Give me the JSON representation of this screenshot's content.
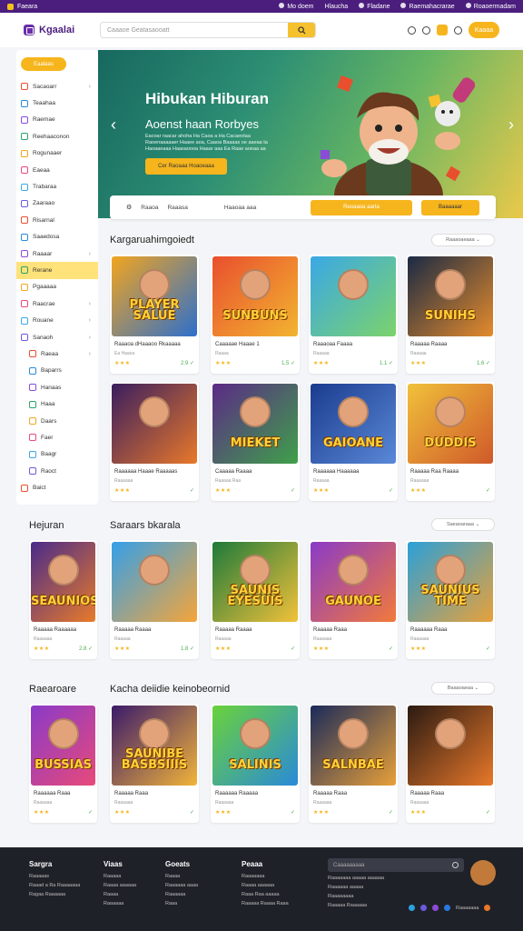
{
  "topbar": {
    "brand": "Faeara",
    "links": [
      "Mo doem",
      "Hlaucha",
      "Fladane",
      "Raemahacrarae",
      "Roaoermadam"
    ]
  },
  "header": {
    "logo": "Kgaalai",
    "search_placeholder": "Caaaoe Geatasaooatt",
    "button": "Kaaaa"
  },
  "sidebar": {
    "top_button": "Eaalaas",
    "items": [
      {
        "label": "Sacaoarr",
        "chev": true
      },
      {
        "label": "Teaahaa",
        "chev": false
      },
      {
        "label": "Raemae",
        "chev": false
      },
      {
        "label": "Reehaaconon",
        "chev": false
      },
      {
        "label": "Rogunaaer",
        "chev": false
      },
      {
        "label": "Eaeaa",
        "chev": false
      },
      {
        "label": "Trabaraa",
        "chev": false
      },
      {
        "label": "Zaaraao",
        "chev": false
      },
      {
        "label": "Risarnal",
        "chev": false
      },
      {
        "label": "Saaedosa",
        "chev": false
      },
      {
        "label": "Raaaar",
        "chev": true
      },
      {
        "label": "Rerane",
        "chev": false,
        "active": true
      },
      {
        "label": "Pgaaaaa",
        "chev": false
      },
      {
        "label": "Raacrae",
        "chev": true
      },
      {
        "label": "Rouane",
        "chev": true
      },
      {
        "label": "Sanaoh",
        "chev": true
      },
      {
        "label": "Raeaa",
        "chev": true,
        "sub": true
      },
      {
        "label": "Baparrs",
        "chev": false,
        "sub": true
      },
      {
        "label": "Hanaas",
        "chev": false,
        "sub": true
      },
      {
        "label": "Haaa",
        "chev": false,
        "sub": true
      },
      {
        "label": "Daars",
        "chev": false,
        "sub": true
      },
      {
        "label": "Faer",
        "chev": false,
        "sub": true
      },
      {
        "label": "Baagr",
        "chev": false,
        "sub": true
      },
      {
        "label": "Raoct",
        "chev": false,
        "sub": true
      },
      {
        "label": "Baict",
        "chev": false
      }
    ]
  },
  "hero": {
    "title": "Hibukan Hiburan",
    "subtitle": "Aoenst haan Rorbyes",
    "desc": "Eacoar raacar ahoha Ha Caoa a Ha Cacaeotaa Raoenaaaaaer Haaee aoa, Caaoa Baaaas oe aaeaa ta Haoaaeaaa Haasaoooa Haaar aaa Ea Raae aoeaa aa",
    "cta": "Cer Raoaaa Hoaoeaaa"
  },
  "tabs": {
    "items": [
      "Raaoa",
      "Raaasa",
      "Haaoaa aaa"
    ],
    "yellow_button": "Reoaaoa aarta",
    "orange_button": "Baaaaaar"
  },
  "sections": [
    {
      "title": "Kargaruahimgoiedt",
      "sort": "Raaaoaeaaa"
    },
    {
      "title": "Hejuran",
      "title2": "Saraars bkarala",
      "sort": "Saeaoaraaa"
    },
    {
      "title": "Raearoare",
      "title2": "Kacha deiidie keinobeornid",
      "sort": "Baaaoaeaa"
    }
  ],
  "games": [
    {
      "word": "PLAYER SALUE",
      "title": "Raaaoa dHaaaoo Rkaaaaa",
      "sub": "Ea Haaoa",
      "meta": "2.9",
      "c1": "#f2a51f",
      "c2": "#2d6fcc"
    },
    {
      "word": "SUNBUNS",
      "title": "Caaaaae Haaae 1",
      "sub": "Raaaa",
      "meta": "1.5",
      "c1": "#e94f2e",
      "c2": "#f2b430"
    },
    {
      "word": "",
      "title": "Raaaoaa Faaaa",
      "sub": "Raaaaa",
      "meta": "1.1",
      "c1": "#3aa8e6",
      "c2": "#7cd36b"
    },
    {
      "word": "SUNIHS",
      "title": "Raaaaa Raaaa",
      "sub": "Raaaaa",
      "meta": "1.6",
      "c1": "#1a2a44",
      "c2": "#e58b2c"
    },
    {
      "word": "",
      "title": "Raaaaaa Haaae Raaaaas",
      "sub": "Raaaaaa",
      "meta": "",
      "c1": "#3a1e5f",
      "c2": "#e8782a"
    },
    {
      "word": "MIEKET",
      "title": "Caaaaa Raaaa",
      "sub": "Raaaaa Raa",
      "meta": "",
      "c1": "#5b2a86",
      "c2": "#3fa04a"
    },
    {
      "word": "GAIOANE",
      "title": "Raaaaaa Haaaaaa",
      "sub": "Raaaaa",
      "meta": "",
      "c1": "#1b3c8e",
      "c2": "#5a88d8"
    },
    {
      "word": "DUDDIS",
      "title": "Raaaaa Raa Raaaa",
      "sub": "Raaaaaa",
      "meta": "",
      "c1": "#f0c13a",
      "c2": "#d0592a"
    },
    {
      "word": "SEAUNIOS",
      "title": "Raaaaa Raaaaaa",
      "sub": "Raaaaaa",
      "meta": "2.8",
      "c1": "#4a2a8a",
      "c2": "#e87b2a"
    },
    {
      "word": "",
      "title": "Raaaaa Raaaa",
      "sub": "Raaaaa",
      "meta": "1.8",
      "c1": "#34a0e8",
      "c2": "#f5a53a"
    },
    {
      "word": "SAUNIS EYESUIS",
      "title": "Raaaaa Raaaa",
      "sub": "Raaaaa",
      "meta": "",
      "c1": "#1e7a3a",
      "c2": "#f2c13a"
    },
    {
      "word": "GAUNOE",
      "title": "Raaaaa Raaa",
      "sub": "Raaaaaa",
      "meta": "",
      "c1": "#8a3ac8",
      "c2": "#f27a3a"
    },
    {
      "word": "SAUNIUS TIME",
      "title": "Raaaaaa Raaa",
      "sub": "Raaaaaa",
      "meta": "",
      "c1": "#2ba0d8",
      "c2": "#e8a13a"
    },
    {
      "word": "BUSSIAS",
      "title": "Raaaaaa Raaa",
      "sub": "Raaaaaa",
      "meta": "",
      "c1": "#8a3ac8",
      "c2": "#e84a7a"
    },
    {
      "word": "SAUNIBE BASBSIIIS",
      "title": "Raaaaa Raaa",
      "sub": "Raaaaaa",
      "meta": "",
      "c1": "#3a1a6a",
      "c2": "#f2b43a"
    },
    {
      "word": "SALINIS",
      "title": "Raaaaaa Raaaaa",
      "sub": "Raaaaaa",
      "meta": "",
      "c1": "#6ad23a",
      "c2": "#2a8ad8"
    },
    {
      "word": "SALNBAE",
      "title": "Raaaaa Raaa",
      "sub": "Raaaaaa",
      "meta": "",
      "c1": "#1a2a5a",
      "c2": "#e8a03a"
    },
    {
      "word": "",
      "title": "Raaaaa Raaa",
      "sub": "Raaaaaa",
      "meta": "",
      "c1": "#2a1a12",
      "c2": "#e8782a"
    }
  ],
  "footer": {
    "cols": [
      {
        "head": "Sargra",
        "links": [
          "Raaaaas",
          "Raaad a Ra Raaaaaaa",
          "Ragaa Raaaaaa"
        ]
      },
      {
        "head": "Viaas",
        "links": [
          "Raaaaa",
          "Raaaa aaaaaa",
          "Raaaa",
          "Raaaaaa"
        ]
      },
      {
        "head": "Goeats",
        "links": [
          "Raaaa",
          "Raaaaaa aaaa",
          "Raaaaaa",
          "Raaa"
        ]
      },
      {
        "head": "Peaaa",
        "links": [
          "Raaaaaaa",
          "Raaaa aaaaaa",
          "Raaa Raa aaaaa",
          "Raaaaa Raaaa Raaa"
        ]
      }
    ],
    "search_placeholder": "Caaaaaaaaa",
    "right_links": [
      "Raaaaaaa aaaaa aaaaaa",
      "Raaaaaa aaaaa",
      "Raaaaaaaa",
      "Raaaaa Raaaaaa"
    ],
    "social_label": "Raaaaaaa"
  }
}
